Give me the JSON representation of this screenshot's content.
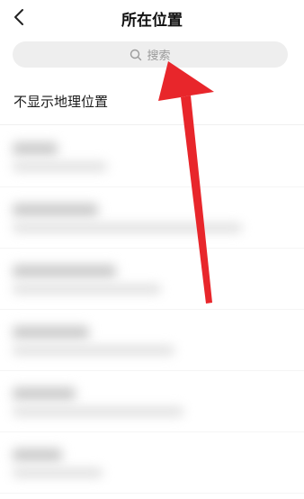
{
  "header": {
    "title": "所在位置",
    "back_icon": "chevron-left-icon"
  },
  "search": {
    "placeholder": "搜索",
    "icon": "search-icon"
  },
  "no_location": {
    "label": "不显示地理位置"
  },
  "annotation": {
    "type": "red-arrow",
    "color": "#e8262b",
    "points_to": "search-bar"
  },
  "colors": {
    "search_bg": "#eeeeee",
    "placeholder": "#9a9a9a",
    "arrow": "#e8262b"
  }
}
